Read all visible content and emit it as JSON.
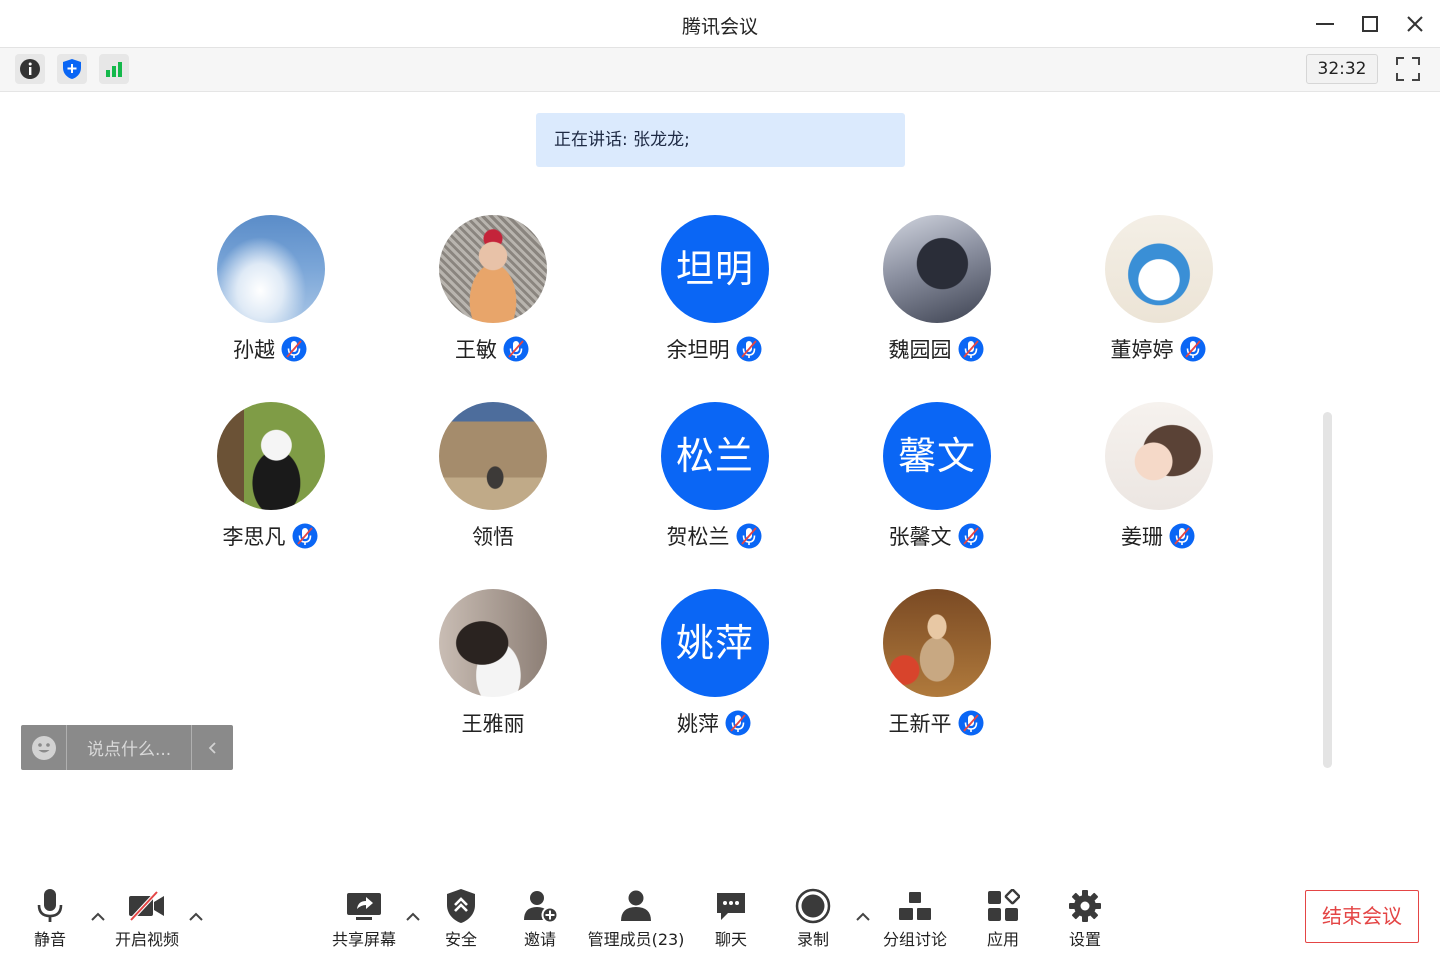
{
  "window": {
    "title": "腾讯会议"
  },
  "infobar": {
    "timer": "32:32"
  },
  "speaking": {
    "text": "正在讲话: 张龙龙;"
  },
  "participants": [
    {
      "name": "孙越",
      "avatar_type": "photo",
      "avatar_icon": "sky-photo",
      "muted": true
    },
    {
      "name": "王敏",
      "avatar_type": "photo",
      "avatar_icon": "woman-sunglasses-photo",
      "muted": true
    },
    {
      "name": "余坦明",
      "avatar_type": "letter",
      "avatar_text": "坦明",
      "muted": true
    },
    {
      "name": "魏园园",
      "avatar_type": "photo",
      "avatar_icon": "silhouette-photo",
      "muted": true
    },
    {
      "name": "董婷婷",
      "avatar_type": "photo",
      "avatar_icon": "doraemon-photo",
      "muted": true
    },
    {
      "name": "李思凡",
      "avatar_type": "photo",
      "avatar_icon": "panda-photo",
      "muted": true
    },
    {
      "name": "领悟",
      "avatar_type": "photo",
      "avatar_icon": "great-wall-photo",
      "muted": false
    },
    {
      "name": "贺松兰",
      "avatar_type": "letter",
      "avatar_text": "松兰",
      "muted": true
    },
    {
      "name": "张馨文",
      "avatar_type": "letter",
      "avatar_text": "馨文",
      "muted": true
    },
    {
      "name": "姜珊",
      "avatar_type": "photo",
      "avatar_icon": "woman-mask-drawing",
      "muted": true
    },
    {
      "name": "王雅丽",
      "avatar_type": "photo",
      "avatar_icon": "girl-photo",
      "muted": false
    },
    {
      "name": "姚萍",
      "avatar_type": "letter",
      "avatar_text": "姚萍",
      "muted": true
    },
    {
      "name": "王新平",
      "avatar_type": "photo",
      "avatar_icon": "woman-painting",
      "muted": true
    }
  ],
  "chat": {
    "placeholder": "说点什么..."
  },
  "toolbar": {
    "mute": "静音",
    "video": "开启视频",
    "share": "共享屏幕",
    "security": "安全",
    "invite": "邀请",
    "members": "管理成员(23)",
    "chat": "聊天",
    "record": "录制",
    "breakout": "分组讨论",
    "apps": "应用",
    "settings": "设置",
    "end": "结束会议"
  },
  "colors": {
    "accent": "#0a66f5",
    "danger": "#e44545",
    "banner": "#dbeafd"
  }
}
